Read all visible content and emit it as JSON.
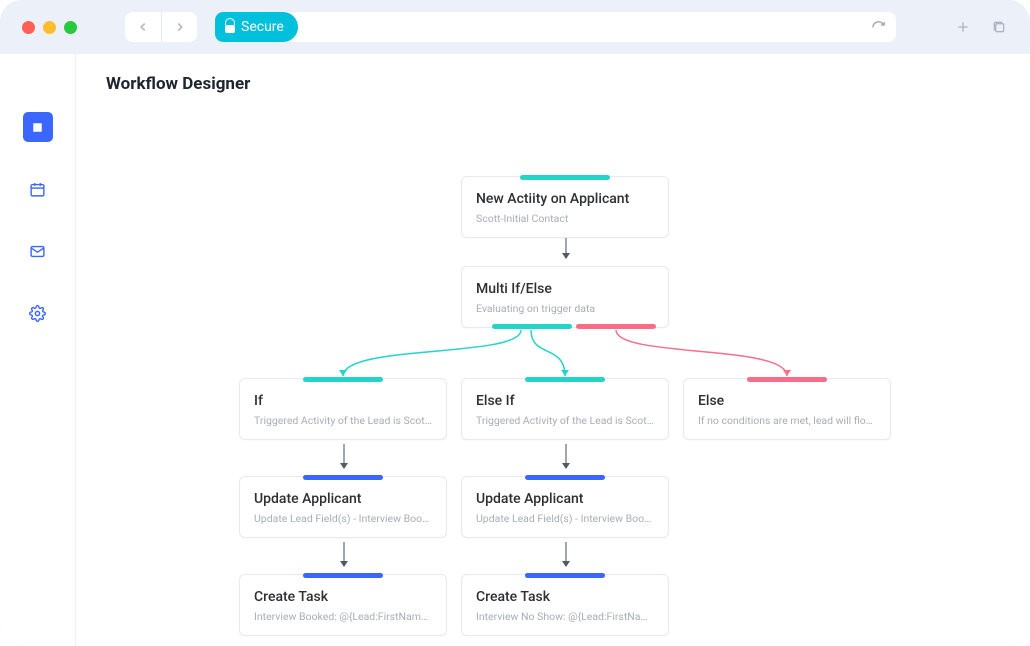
{
  "chrome": {
    "secure_label": "Secure"
  },
  "page": {
    "title": "Workflow Designer"
  },
  "nodes": {
    "trigger": {
      "title": "New Actiity on Applicant",
      "subtitle": "Scott-Initial Contact"
    },
    "multi": {
      "title": "Multi If/Else",
      "subtitle": "Evaluating on trigger data"
    },
    "if": {
      "title": "If",
      "subtitle": "Triggered Activity of the Lead is Scott…"
    },
    "elseif": {
      "title": "Else If",
      "subtitle": "Triggered Activity of the Lead is Scott…"
    },
    "else": {
      "title": "Else",
      "subtitle": "If no conditions are met, lead will flow…"
    },
    "update_a": {
      "title": "Update Applicant",
      "subtitle": "Update Lead Field(s) - Interview Booked"
    },
    "update_b": {
      "title": "Update Applicant",
      "subtitle": "Update Lead Field(s) - Interview Booked"
    },
    "task_a": {
      "title": "Create Task",
      "subtitle": "Interview Booked: @{Lead:FirstName,}…"
    },
    "task_b": {
      "title": "Create Task",
      "subtitle": "Interview No Show: @{Lead:FirstName,}…"
    }
  },
  "colors": {
    "teal": "#23d5c8",
    "pink": "#f76d8a",
    "blue": "#3b66ff"
  }
}
